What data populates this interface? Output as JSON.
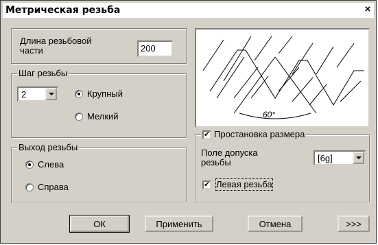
{
  "window": {
    "title": "Метрическая резьба",
    "close_symbol": "×"
  },
  "length": {
    "label": "Длина резьбовой\nчасти",
    "label_line1": "Длина резьбовой",
    "label_line2": "части",
    "value": "200"
  },
  "pitch": {
    "legend": "Шаг резьбы",
    "value": "2",
    "options": [
      {
        "label": "Крупный",
        "selected": true
      },
      {
        "label": "Мелкий",
        "selected": false
      }
    ]
  },
  "exit": {
    "legend": "Выход резьбы",
    "options": [
      {
        "label": "Слева",
        "selected": true
      },
      {
        "label": "Справа",
        "selected": false
      }
    ]
  },
  "diagram": {
    "angle_label": "60°"
  },
  "dimension": {
    "checkbox_label": "Простановка размера",
    "checked": true,
    "tolerance_label_line1": "Поле допуска",
    "tolerance_label_line2": "резьбы",
    "tolerance_value": "[6g]",
    "left_thread_label": "Левая резьба",
    "left_thread_checked": true,
    "check_mark": "✔"
  },
  "buttons": {
    "ok": "ОК",
    "apply": "Применить",
    "cancel": "Отмена",
    "more": ">>>"
  }
}
